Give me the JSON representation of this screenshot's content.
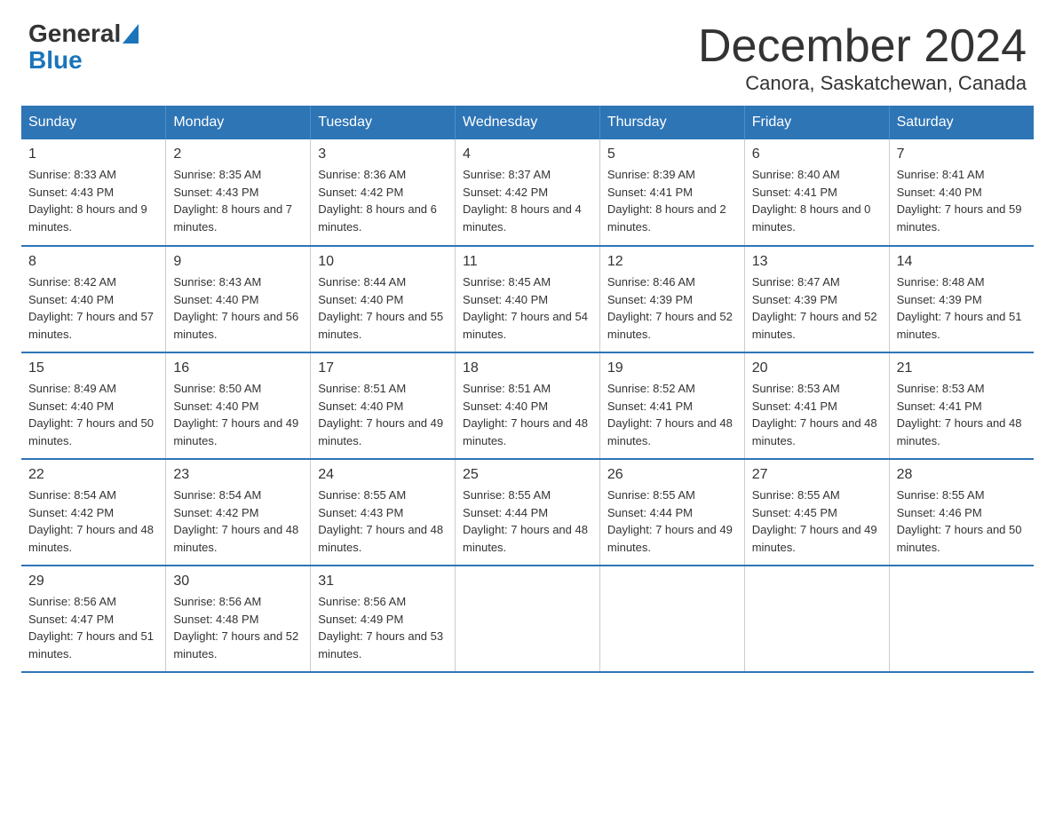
{
  "header": {
    "logo": {
      "general": "General",
      "blue": "Blue"
    },
    "title": "December 2024",
    "subtitle": "Canora, Saskatchewan, Canada"
  },
  "calendar": {
    "weekdays": [
      "Sunday",
      "Monday",
      "Tuesday",
      "Wednesday",
      "Thursday",
      "Friday",
      "Saturday"
    ],
    "weeks": [
      [
        {
          "day": "1",
          "sunrise": "8:33 AM",
          "sunset": "4:43 PM",
          "daylight": "8 hours and 9 minutes."
        },
        {
          "day": "2",
          "sunrise": "8:35 AM",
          "sunset": "4:43 PM",
          "daylight": "8 hours and 7 minutes."
        },
        {
          "day": "3",
          "sunrise": "8:36 AM",
          "sunset": "4:42 PM",
          "daylight": "8 hours and 6 minutes."
        },
        {
          "day": "4",
          "sunrise": "8:37 AM",
          "sunset": "4:42 PM",
          "daylight": "8 hours and 4 minutes."
        },
        {
          "day": "5",
          "sunrise": "8:39 AM",
          "sunset": "4:41 PM",
          "daylight": "8 hours and 2 minutes."
        },
        {
          "day": "6",
          "sunrise": "8:40 AM",
          "sunset": "4:41 PM",
          "daylight": "8 hours and 0 minutes."
        },
        {
          "day": "7",
          "sunrise": "8:41 AM",
          "sunset": "4:40 PM",
          "daylight": "7 hours and 59 minutes."
        }
      ],
      [
        {
          "day": "8",
          "sunrise": "8:42 AM",
          "sunset": "4:40 PM",
          "daylight": "7 hours and 57 minutes."
        },
        {
          "day": "9",
          "sunrise": "8:43 AM",
          "sunset": "4:40 PM",
          "daylight": "7 hours and 56 minutes."
        },
        {
          "day": "10",
          "sunrise": "8:44 AM",
          "sunset": "4:40 PM",
          "daylight": "7 hours and 55 minutes."
        },
        {
          "day": "11",
          "sunrise": "8:45 AM",
          "sunset": "4:40 PM",
          "daylight": "7 hours and 54 minutes."
        },
        {
          "day": "12",
          "sunrise": "8:46 AM",
          "sunset": "4:39 PM",
          "daylight": "7 hours and 52 minutes."
        },
        {
          "day": "13",
          "sunrise": "8:47 AM",
          "sunset": "4:39 PM",
          "daylight": "7 hours and 52 minutes."
        },
        {
          "day": "14",
          "sunrise": "8:48 AM",
          "sunset": "4:39 PM",
          "daylight": "7 hours and 51 minutes."
        }
      ],
      [
        {
          "day": "15",
          "sunrise": "8:49 AM",
          "sunset": "4:40 PM",
          "daylight": "7 hours and 50 minutes."
        },
        {
          "day": "16",
          "sunrise": "8:50 AM",
          "sunset": "4:40 PM",
          "daylight": "7 hours and 49 minutes."
        },
        {
          "day": "17",
          "sunrise": "8:51 AM",
          "sunset": "4:40 PM",
          "daylight": "7 hours and 49 minutes."
        },
        {
          "day": "18",
          "sunrise": "8:51 AM",
          "sunset": "4:40 PM",
          "daylight": "7 hours and 48 minutes."
        },
        {
          "day": "19",
          "sunrise": "8:52 AM",
          "sunset": "4:41 PM",
          "daylight": "7 hours and 48 minutes."
        },
        {
          "day": "20",
          "sunrise": "8:53 AM",
          "sunset": "4:41 PM",
          "daylight": "7 hours and 48 minutes."
        },
        {
          "day": "21",
          "sunrise": "8:53 AM",
          "sunset": "4:41 PM",
          "daylight": "7 hours and 48 minutes."
        }
      ],
      [
        {
          "day": "22",
          "sunrise": "8:54 AM",
          "sunset": "4:42 PM",
          "daylight": "7 hours and 48 minutes."
        },
        {
          "day": "23",
          "sunrise": "8:54 AM",
          "sunset": "4:42 PM",
          "daylight": "7 hours and 48 minutes."
        },
        {
          "day": "24",
          "sunrise": "8:55 AM",
          "sunset": "4:43 PM",
          "daylight": "7 hours and 48 minutes."
        },
        {
          "day": "25",
          "sunrise": "8:55 AM",
          "sunset": "4:44 PM",
          "daylight": "7 hours and 48 minutes."
        },
        {
          "day": "26",
          "sunrise": "8:55 AM",
          "sunset": "4:44 PM",
          "daylight": "7 hours and 49 minutes."
        },
        {
          "day": "27",
          "sunrise": "8:55 AM",
          "sunset": "4:45 PM",
          "daylight": "7 hours and 49 minutes."
        },
        {
          "day": "28",
          "sunrise": "8:55 AM",
          "sunset": "4:46 PM",
          "daylight": "7 hours and 50 minutes."
        }
      ],
      [
        {
          "day": "29",
          "sunrise": "8:56 AM",
          "sunset": "4:47 PM",
          "daylight": "7 hours and 51 minutes."
        },
        {
          "day": "30",
          "sunrise": "8:56 AM",
          "sunset": "4:48 PM",
          "daylight": "7 hours and 52 minutes."
        },
        {
          "day": "31",
          "sunrise": "8:56 AM",
          "sunset": "4:49 PM",
          "daylight": "7 hours and 53 minutes."
        },
        null,
        null,
        null,
        null
      ]
    ]
  }
}
